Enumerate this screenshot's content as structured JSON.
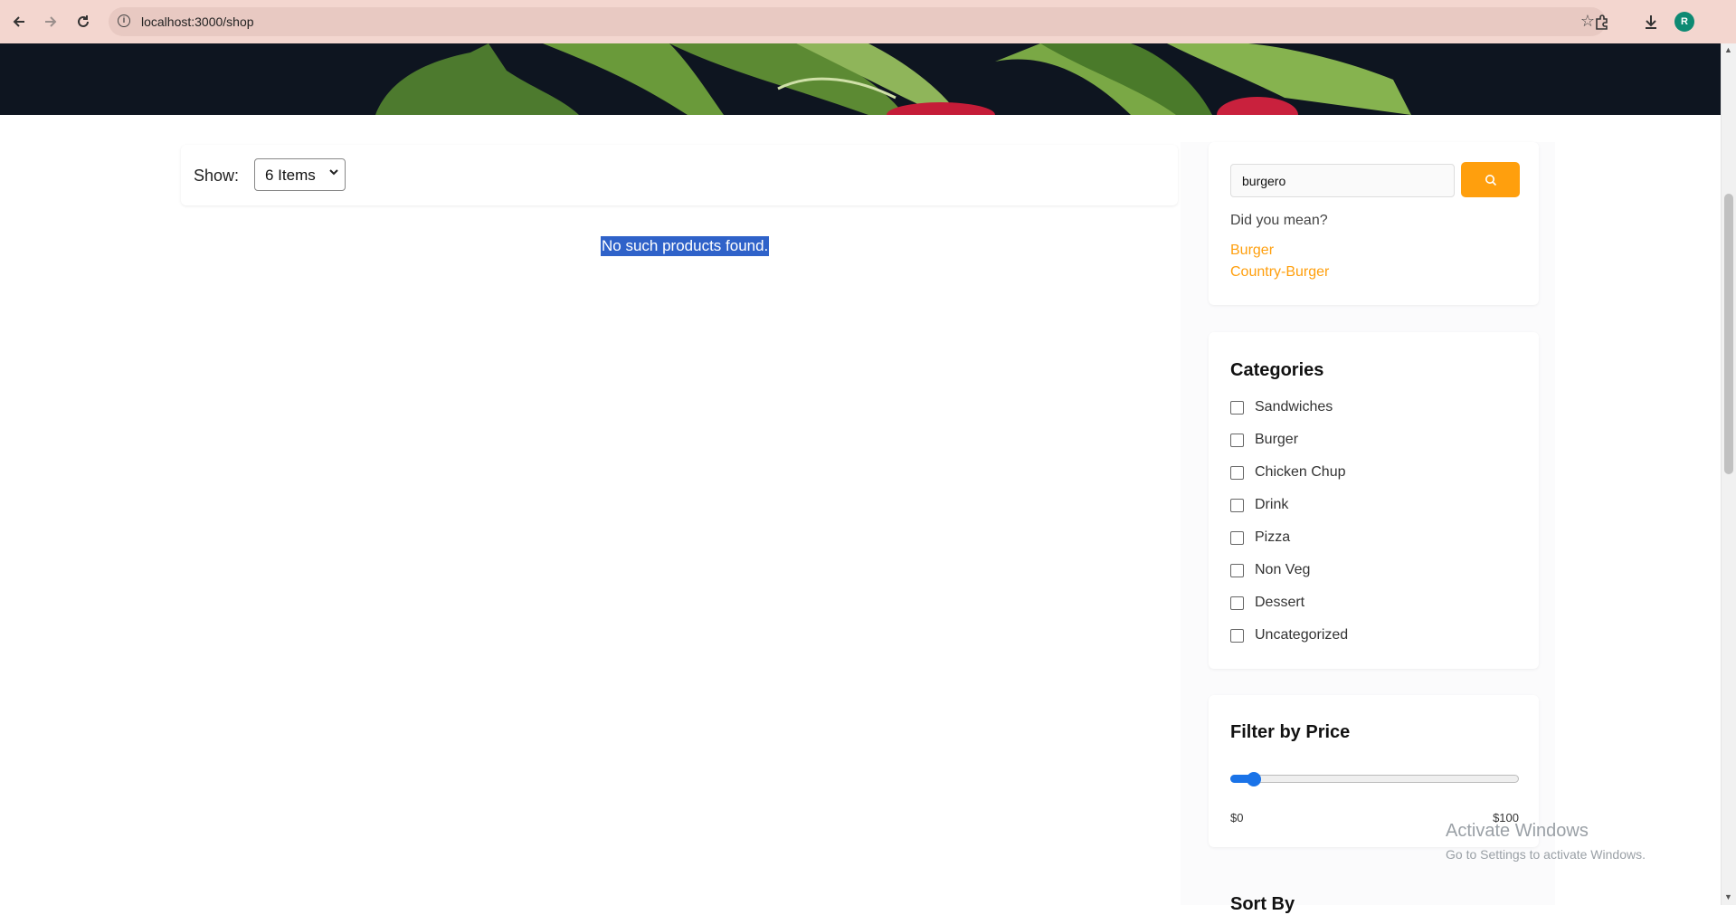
{
  "browser": {
    "url": "localhost:3000/shop",
    "back_icon": "arrow-left-icon",
    "forward_icon": "arrow-right-icon",
    "reload_icon": "reload-icon",
    "avatar_letter": "R"
  },
  "toolbar": {
    "show_label": "Show:",
    "show_value": "6 Items"
  },
  "results": {
    "empty_message": "No such products found."
  },
  "search": {
    "query": "burgero",
    "did_you_mean_label": "Did you mean?",
    "suggestions": [
      "Burger",
      "Country-Burger"
    ]
  },
  "categories": {
    "title": "Categories",
    "items": [
      "Sandwiches",
      "Burger",
      "Chicken Chup",
      "Drink",
      "Pizza",
      "Non Veg",
      "Dessert",
      "Uncategorized"
    ]
  },
  "price_filter": {
    "title": "Filter by Price",
    "min_label": "$0",
    "max_label": "$100",
    "value_fraction": 0.06
  },
  "sort": {
    "title": "Sort By"
  },
  "os_overlay": {
    "line1": "Activate Windows",
    "line2": "Go to Settings to activate Windows."
  },
  "colors": {
    "accent": "#ff9f0d",
    "selection": "#2f62c9",
    "slider": "#1a73e8"
  }
}
